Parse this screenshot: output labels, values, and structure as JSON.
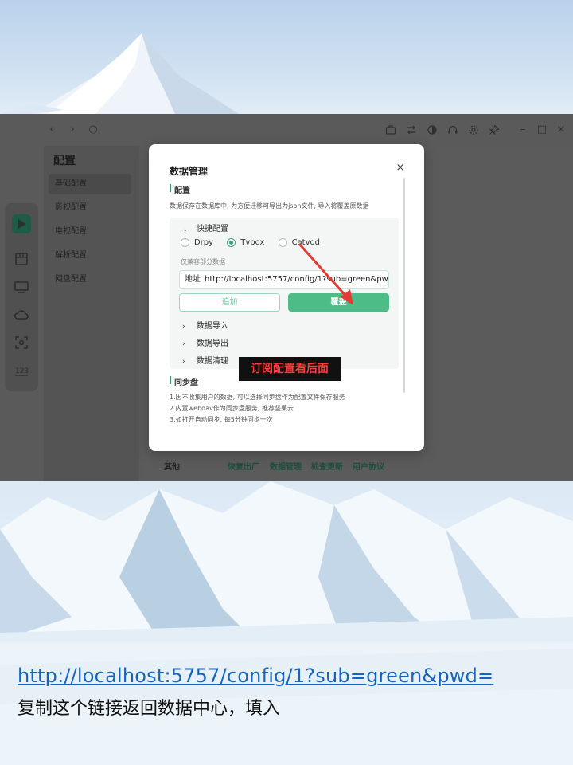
{
  "app": {
    "nav_title": "配置",
    "nav_items": [
      {
        "label": "基础配置",
        "active": true
      },
      {
        "label": "影视配置",
        "active": false
      },
      {
        "label": "电视配置",
        "active": false
      },
      {
        "label": "解析配置",
        "active": false
      },
      {
        "label": "网盘配置",
        "active": false
      }
    ],
    "leftbar_icons": [
      "film-icon",
      "tv-icon",
      "cloud-icon",
      "scan-icon",
      "numbers-icon"
    ],
    "leftbar_numbers_label": "123",
    "footer": {
      "label": "其他",
      "links": [
        "恢复出厂",
        "数据管理",
        "检查更新",
        "用户协议"
      ]
    }
  },
  "dialog": {
    "title": "数据管理",
    "close": "×",
    "config_heading": "配置",
    "config_desc": "数据保存在数据库中, 为方便迁移可导出为json文件, 导入将覆盖原数据",
    "quick": {
      "title": "快捷配置",
      "options": [
        {
          "label": "Drpy",
          "selected": false
        },
        {
          "label": "Tvbox",
          "selected": true
        },
        {
          "label": "Catvod",
          "selected": false
        }
      ],
      "hint": "仅兼容部分数据",
      "url_label": "地址",
      "url_value": "http://localhost:5757/config/1?sub=green&pwd=",
      "add_label": "追加",
      "cover_label": "覆盖"
    },
    "sections": [
      "数据导入",
      "数据导出",
      "数据清理"
    ],
    "sync_heading": "同步盘",
    "sync_items": [
      "1.因不收集用户的数据, 可以选择同步盘作为配置文件保存服务",
      "2.内置webdav作为同步盘服务, 推荐坚果云",
      "3.如打开自动同步, 每5分钟同步一次"
    ]
  },
  "annotation": "订阅配置看后面",
  "caption": {
    "link": "http://localhost:5757/config/1?sub=green&pwd=",
    "text": "复制这个链接返回数据中心，填入"
  },
  "colors": {
    "accent": "#4ebc86",
    "annotation_text": "#ff3b3b",
    "caption_link": "#1565c0"
  }
}
